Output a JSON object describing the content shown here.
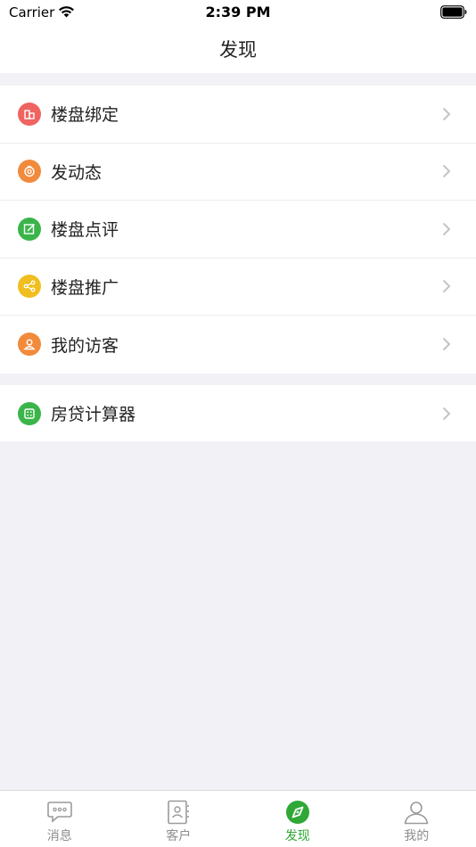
{
  "status_bar": {
    "carrier": "Carrier",
    "time": "2:39 PM"
  },
  "nav": {
    "title": "发现"
  },
  "groups": [
    {
      "items": [
        {
          "label": "楼盘绑定",
          "icon": "building-icon",
          "color": "#ef6461"
        },
        {
          "label": "发动态",
          "icon": "camera-icon",
          "color": "#f28a3c"
        },
        {
          "label": "楼盘点评",
          "icon": "edit-icon",
          "color": "#3bb54a"
        },
        {
          "label": "楼盘推广",
          "icon": "share-icon",
          "color": "#f0be1e"
        },
        {
          "label": "我的访客",
          "icon": "person-icon",
          "color": "#f28a3c"
        }
      ]
    },
    {
      "items": [
        {
          "label": "房贷计算器",
          "icon": "calculator-icon",
          "color": "#3bb54a"
        }
      ]
    }
  ],
  "tab_bar": {
    "active_color": "#2fa836",
    "tabs": [
      {
        "label": "消息",
        "icon": "chat-bubble-icon",
        "active": false
      },
      {
        "label": "客户",
        "icon": "contacts-icon",
        "active": false
      },
      {
        "label": "发现",
        "icon": "compass-icon",
        "active": true
      },
      {
        "label": "我的",
        "icon": "profile-icon",
        "active": false
      }
    ]
  }
}
